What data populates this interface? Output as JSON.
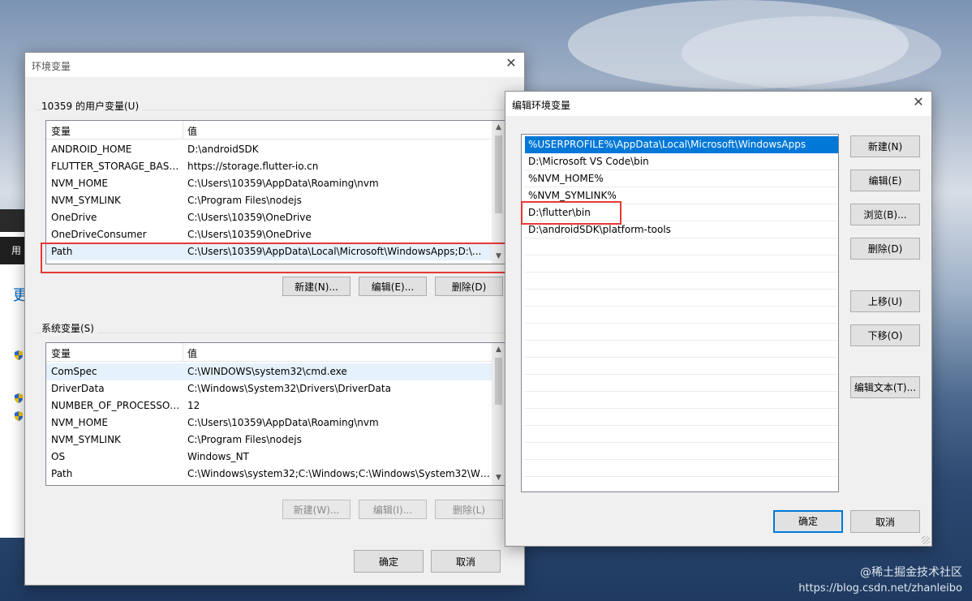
{
  "env_window": {
    "title": "环境变量",
    "user_group_label": "10359 的用户变量(U)",
    "system_group_label": "系统变量(S)",
    "col_var": "变量",
    "col_val": "值",
    "user_vars": [
      {
        "name": "ANDROID_HOME",
        "value": "D:\\androidSDK"
      },
      {
        "name": "FLUTTER_STORAGE_BASE_...",
        "value": "https://storage.flutter-io.cn"
      },
      {
        "name": "NVM_HOME",
        "value": "C:\\Users\\10359\\AppData\\Roaming\\nvm"
      },
      {
        "name": "NVM_SYMLINK",
        "value": "C:\\Program Files\\nodejs"
      },
      {
        "name": "OneDrive",
        "value": "C:\\Users\\10359\\OneDrive"
      },
      {
        "name": "OneDriveConsumer",
        "value": "C:\\Users\\10359\\OneDrive"
      },
      {
        "name": "Path",
        "value": "C:\\Users\\10359\\AppData\\Local\\Microsoft\\WindowsApps;D:\\..."
      }
    ],
    "user_buttons": {
      "new": "新建(N)...",
      "edit": "编辑(E)...",
      "delete": "删除(D)"
    },
    "system_vars": [
      {
        "name": "ComSpec",
        "value": "C:\\WINDOWS\\system32\\cmd.exe"
      },
      {
        "name": "DriverData",
        "value": "C:\\Windows\\System32\\Drivers\\DriverData"
      },
      {
        "name": "NUMBER_OF_PROCESSORS",
        "value": "12"
      },
      {
        "name": "NVM_HOME",
        "value": "C:\\Users\\10359\\AppData\\Roaming\\nvm"
      },
      {
        "name": "NVM_SYMLINK",
        "value": "C:\\Program Files\\nodejs"
      },
      {
        "name": "OS",
        "value": "Windows_NT"
      },
      {
        "name": "Path",
        "value": "C:\\Windows\\system32;C:\\Windows;C:\\Windows\\System32\\Wb..."
      }
    ],
    "system_buttons": {
      "new": "新建(W)...",
      "edit": "编辑(I)...",
      "delete": "删除(L)"
    },
    "ok": "确定",
    "cancel": "取消"
  },
  "edit_window": {
    "title": "编辑环境变量",
    "paths": [
      "%USERPROFILE%\\AppData\\Local\\Microsoft\\WindowsApps",
      "D:\\Microsoft VS Code\\bin",
      "%NVM_HOME%",
      "%NVM_SYMLINK%",
      "D:\\flutter\\bin",
      "D:\\androidSDK\\platform-tools"
    ],
    "buttons": {
      "new": "新建(N)",
      "edit": "编辑(E)",
      "browse": "浏览(B)...",
      "delete": "删除(D)",
      "move_up": "上移(U)",
      "move_down": "下移(O)",
      "edit_text": "编辑文本(T)..."
    },
    "ok": "确定",
    "cancel": "取消"
  },
  "background": {
    "taskbar_snippet": "用户",
    "left_text": "更"
  },
  "watermark": {
    "line1": "@稀土掘金技术社区",
    "line2": "https://blog.csdn.net/zhanleibo"
  }
}
